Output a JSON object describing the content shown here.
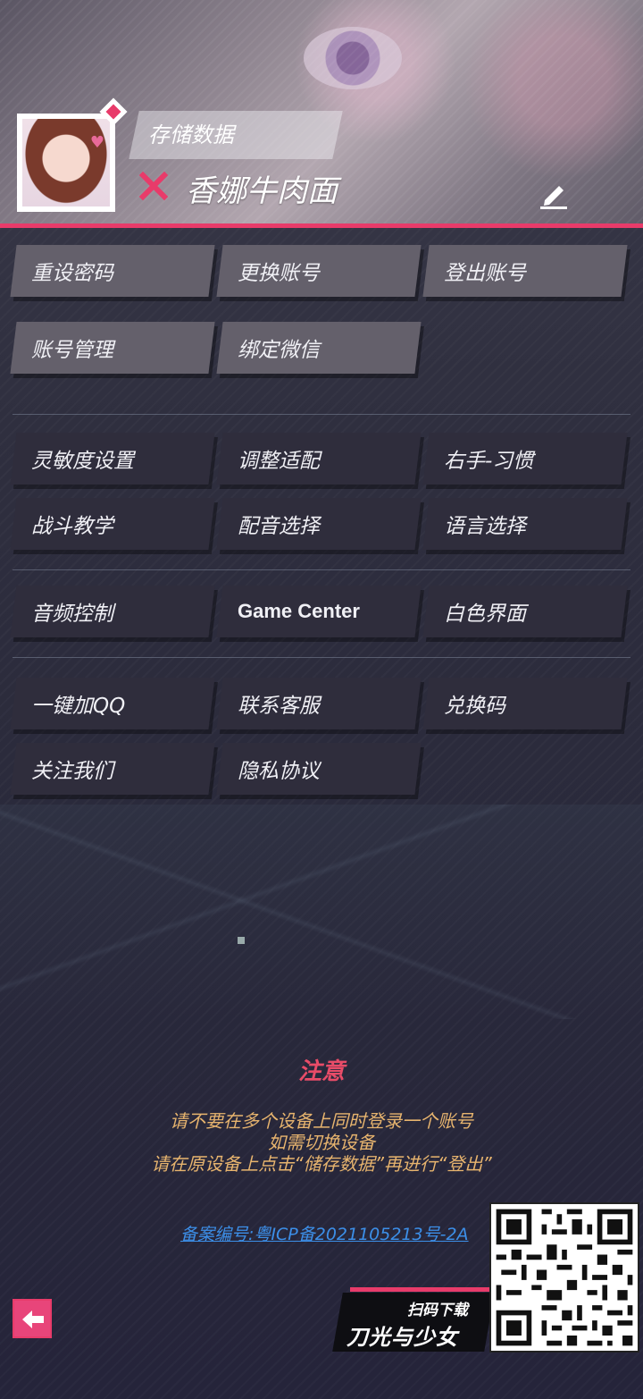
{
  "profile": {
    "storage_label": "存储数据",
    "player_name": "香娜牛肉面"
  },
  "account_buttons": [
    {
      "label": "重设密码"
    },
    {
      "label": "更换账号"
    },
    {
      "label": "登出账号"
    },
    {
      "label": "账号管理"
    },
    {
      "label": "绑定微信"
    }
  ],
  "settings_buttons": [
    {
      "label": "灵敏度设置"
    },
    {
      "label": "调整适配"
    },
    {
      "label": "右手-习惯"
    },
    {
      "label": "战斗教学"
    },
    {
      "label": "配音选择"
    },
    {
      "label": "语言选择"
    },
    {
      "label": "音频控制"
    },
    {
      "label": "Game Center"
    },
    {
      "label": "白色界面"
    }
  ],
  "social_buttons": [
    {
      "label": "一键加QQ"
    },
    {
      "label": "联系客服"
    },
    {
      "label": "兑换码"
    },
    {
      "label": "关注我们"
    },
    {
      "label": "隐私协议"
    }
  ],
  "notice": {
    "title": "注意",
    "lines": [
      "请不要在多个设备上同时登录一个账号",
      "如需切换设备",
      "请在原设备上点击“储存数据”再进行“登出”"
    ]
  },
  "icp_text": "备案编号:粤ICP备2021105213号-2A",
  "promo": {
    "scan_label": "扫码下载",
    "game_name": "刀光与少女"
  },
  "colors": {
    "accent": "#e83b6a",
    "notice_text": "#e7b46e",
    "link": "#3c8fe8"
  }
}
